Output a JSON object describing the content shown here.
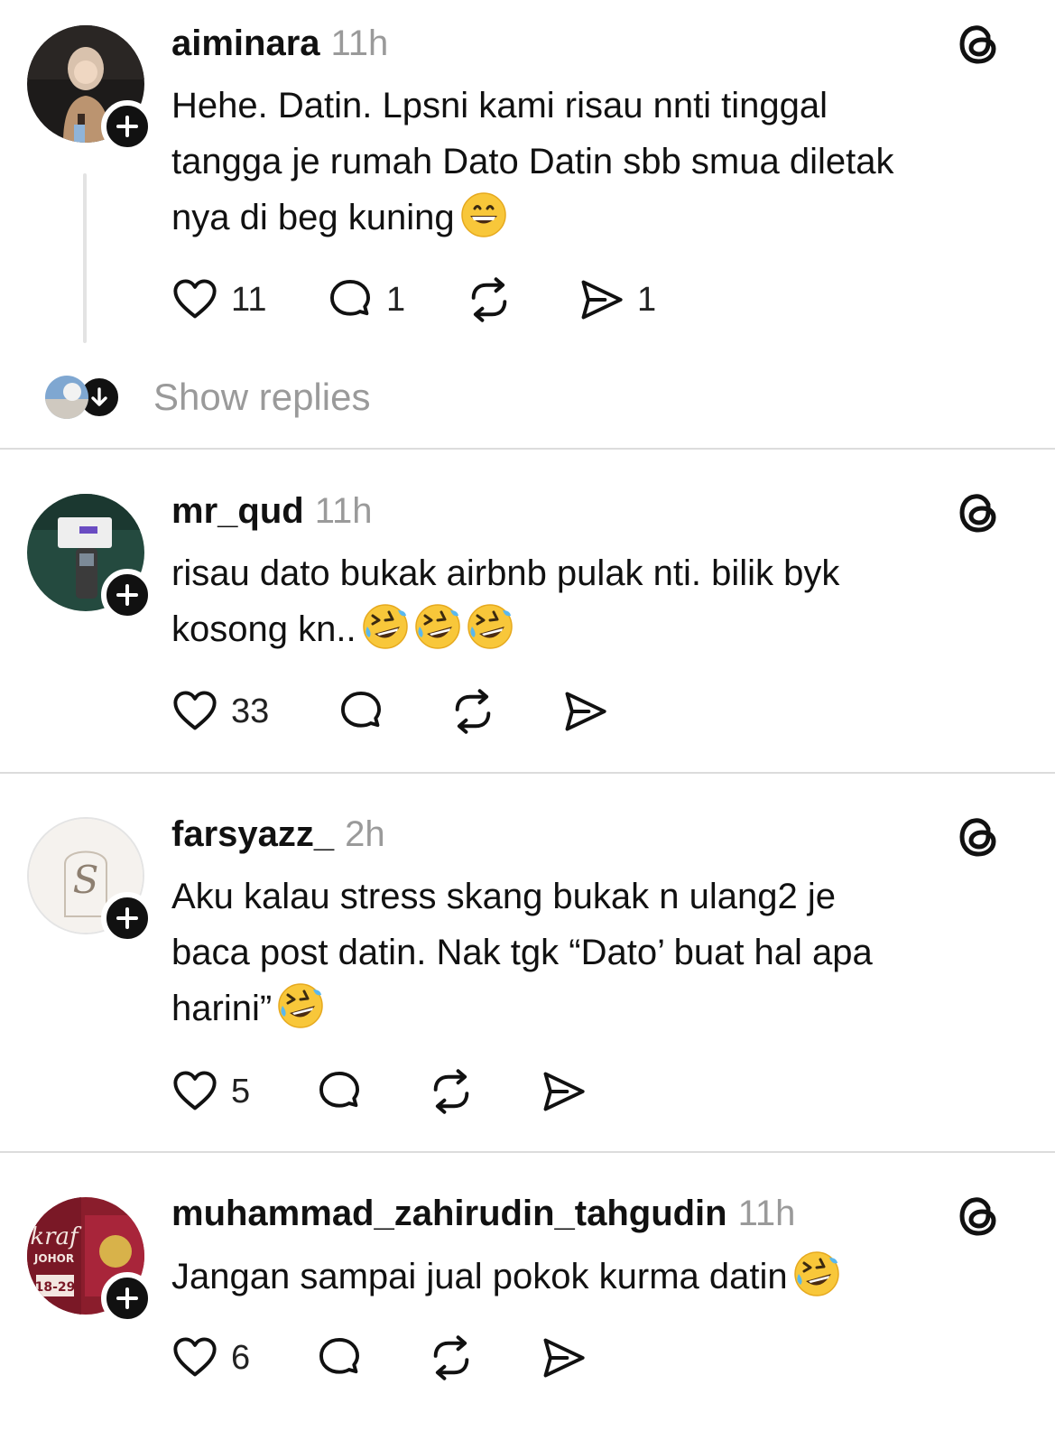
{
  "posts": [
    {
      "username": "aiminara",
      "time": "11h",
      "text": "Hehe. Datin. Lpsni kami risau nnti tinggal\ntangga je rumah Dato Datin sbb smua diletak\nnya di beg kuning",
      "emoji": "grinning-face",
      "likes": "11",
      "replies": "1",
      "reposts": "",
      "shares": "1"
    },
    {
      "username": "mr_qud",
      "time": "11h",
      "text": "risau dato bukak airbnb pulak nti. bilik byk\nkosong kn..",
      "emoji": "rolling-on-floor-laughing x3",
      "likes": "33",
      "replies": "",
      "reposts": "",
      "shares": ""
    },
    {
      "username": "farsyazz_",
      "time": "2h",
      "text": "Aku kalau stress skang bukak n ulang2 je\nbaca post datin. Nak tgk “Dato’ buat hal apa\nharini”",
      "emoji": "rolling-on-floor-laughing",
      "likes": "5",
      "replies": "",
      "reposts": "",
      "shares": ""
    },
    {
      "username": "muhammad_zahirudin_tahgudin",
      "time": "11h",
      "text": "Jangan sampai jual pokok kurma datin",
      "emoji": "rolling-on-floor-laughing",
      "likes": "6",
      "replies": "",
      "reposts": "",
      "shares": ""
    }
  ],
  "show_replies_label": "Show replies",
  "icons": {
    "like": "heart-icon",
    "reply": "comment-bubble-icon",
    "repost": "repost-icon",
    "share": "send-icon",
    "platform": "threads-icon",
    "follow": "plus-icon"
  },
  "colors": {
    "text": "#111111",
    "muted": "#9a9a9a",
    "divider": "#dcdcdc"
  }
}
